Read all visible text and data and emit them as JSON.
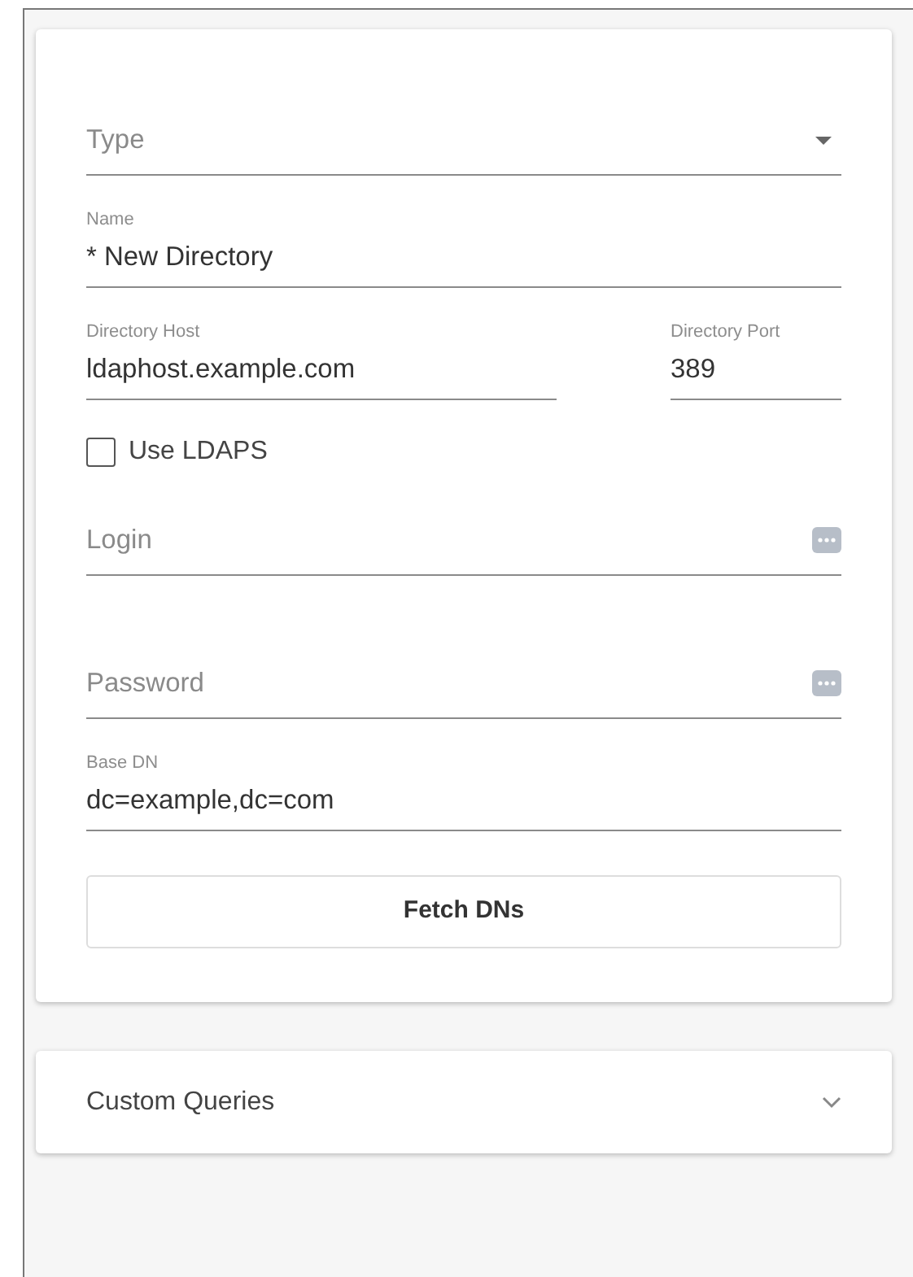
{
  "form": {
    "fields": [
      {
        "kind": "select",
        "placeholder": "Type"
      },
      {
        "kind": "text",
        "label": "Name",
        "value": "* New Directory"
      },
      {
        "kind": "pair",
        "items": [
          {
            "label": "Directory Host",
            "value": "ldaphost.example.com"
          },
          {
            "label": "Directory Port",
            "value": "389"
          }
        ]
      },
      {
        "kind": "checkbox",
        "label": "Use LDAPS",
        "checked": false
      },
      {
        "kind": "secret",
        "placeholder": "Login"
      },
      {
        "kind": "secret",
        "placeholder": "Password"
      },
      {
        "kind": "text",
        "label": "Base DN",
        "value": "dc=example,dc=com"
      }
    ],
    "button": "Fetch DNs"
  },
  "panel": {
    "title": "Custom Queries",
    "expanded": false
  }
}
